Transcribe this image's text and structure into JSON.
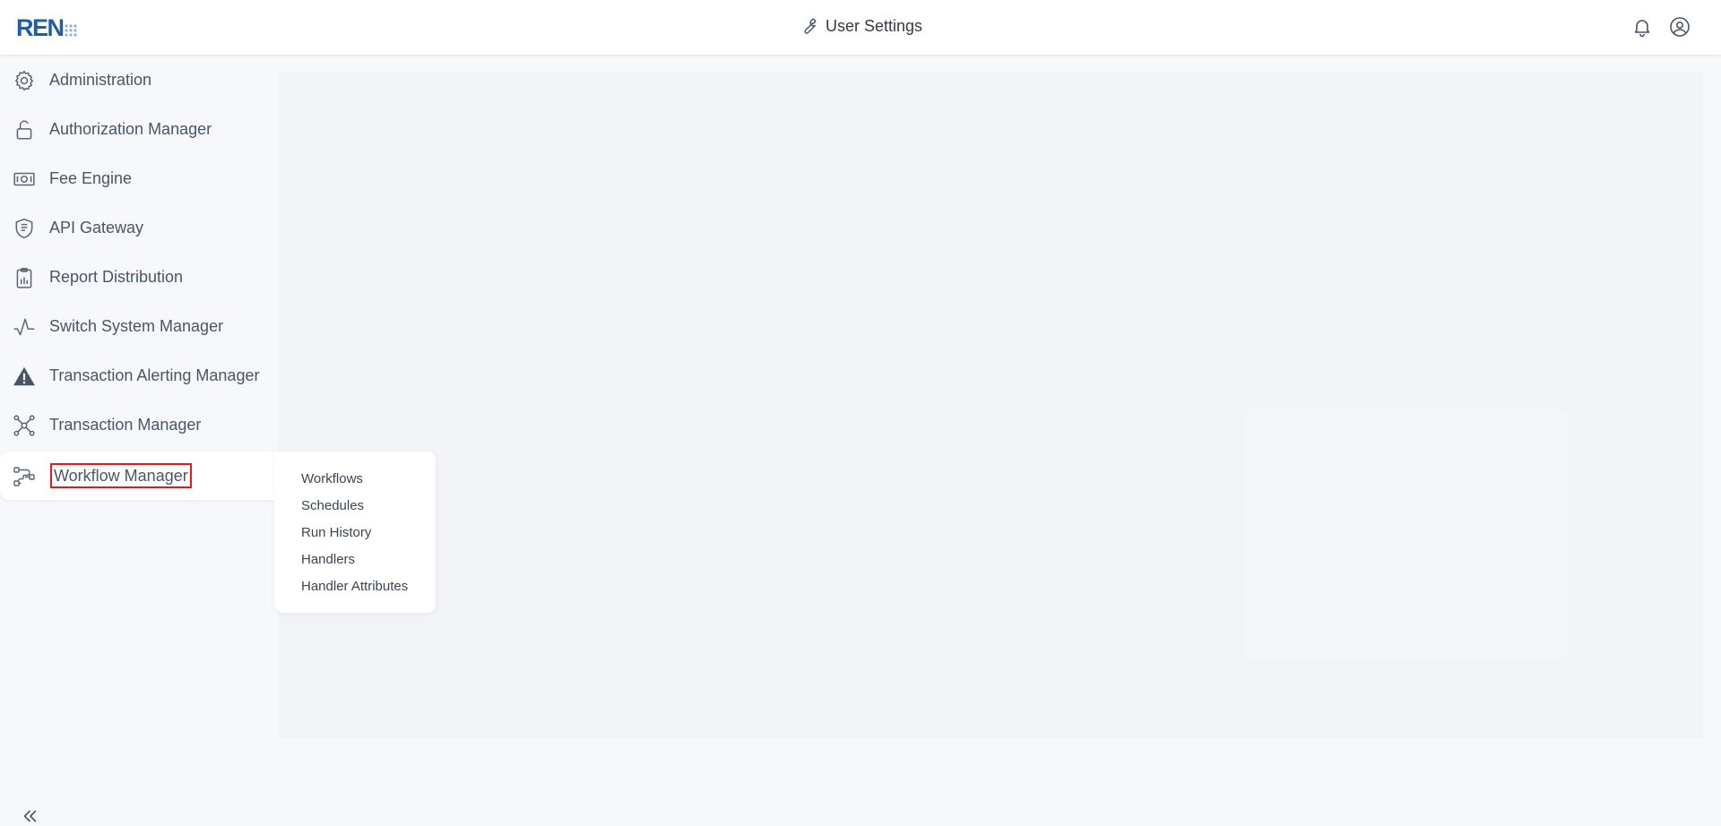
{
  "header": {
    "logo_text": "REN",
    "title": "User Settings",
    "icons": [
      "wrench-icon",
      "bell-icon",
      "user-circle-icon"
    ]
  },
  "sidebar": {
    "items": [
      {
        "label": "Administration",
        "icon": "gear-icon"
      },
      {
        "label": "Authorization Manager",
        "icon": "unlock-icon"
      },
      {
        "label": "Fee Engine",
        "icon": "banknote-icon"
      },
      {
        "label": "API Gateway",
        "icon": "shield-icon"
      },
      {
        "label": "Report Distribution",
        "icon": "clipboard-icon"
      },
      {
        "label": "Switch System Manager",
        "icon": "pulse-icon"
      },
      {
        "label": "Transaction Alerting Manager",
        "icon": "warning-icon"
      },
      {
        "label": "Transaction Manager",
        "icon": "network-icon"
      },
      {
        "label": "Workflow Manager",
        "icon": "workflow-icon",
        "active": true
      }
    ],
    "collapse_icon": "double-chevron-left-icon"
  },
  "submenu": {
    "items": [
      "Workflows",
      "Schedules",
      "Run History",
      "Handlers",
      "Handler Attributes"
    ]
  },
  "colors": {
    "brand": "#1f5fa3",
    "highlight_border": "#e01a1a",
    "page_bg": "#f6f8fb"
  }
}
